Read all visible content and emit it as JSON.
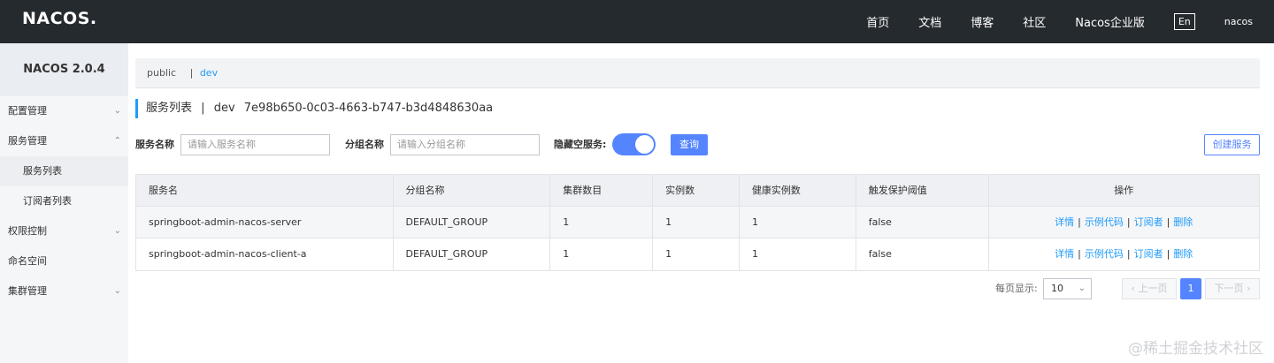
{
  "header": {
    "logo": "NACOS.",
    "nav": [
      "首页",
      "文档",
      "博客",
      "社区",
      "Nacos企业版"
    ],
    "lang": "En",
    "user": "nacos"
  },
  "sidebar": {
    "version": "NACOS 2.0.4",
    "items": [
      {
        "label": "配置管理",
        "icon": "chevron-down-icon"
      },
      {
        "label": "服务管理",
        "icon": "chevron-up-icon"
      },
      {
        "label": "服务列表"
      },
      {
        "label": "订阅者列表"
      },
      {
        "label": "权限控制",
        "icon": "chevron-down-icon"
      },
      {
        "label": "命名空间"
      },
      {
        "label": "集群管理",
        "icon": "chevron-down-icon"
      }
    ]
  },
  "namespaces": {
    "items": [
      "public",
      "dev"
    ],
    "separator": "|",
    "active": "dev"
  },
  "page": {
    "title": "服务列表",
    "separator": "|",
    "ns_name": "dev",
    "ns_id": "7e98b650-0c03-4663-b747-b3d4848630aa"
  },
  "filters": {
    "service_name_label": "服务名称",
    "service_name_placeholder": "请输入服务名称",
    "group_name_label": "分组名称",
    "group_name_placeholder": "请输入分组名称",
    "hide_empty_label": "隐藏空服务:",
    "hide_empty_on": true,
    "query_button": "查询",
    "create_button": "创建服务"
  },
  "table": {
    "columns": [
      "服务名",
      "分组名称",
      "集群数目",
      "实例数",
      "健康实例数",
      "触发保护阈值",
      "操作"
    ],
    "rows": [
      [
        "springboot-admin-nacos-server",
        "DEFAULT_GROUP",
        "1",
        "1",
        "1",
        "false"
      ],
      [
        "springboot-admin-nacos-client-a",
        "DEFAULT_GROUP",
        "1",
        "1",
        "1",
        "false"
      ]
    ],
    "actions": [
      "详情",
      "示例代码",
      "订阅者",
      "删除"
    ],
    "action_separator": "|"
  },
  "pagination": {
    "page_size_label": "每页显示:",
    "page_size": "10",
    "prev": "上一页",
    "current": "1",
    "next": "下一页"
  },
  "watermark": "@稀土掘金技术社区",
  "colors": {
    "topbar": "#252a2f",
    "primary": "#5584ff",
    "link": "#209bfa"
  }
}
